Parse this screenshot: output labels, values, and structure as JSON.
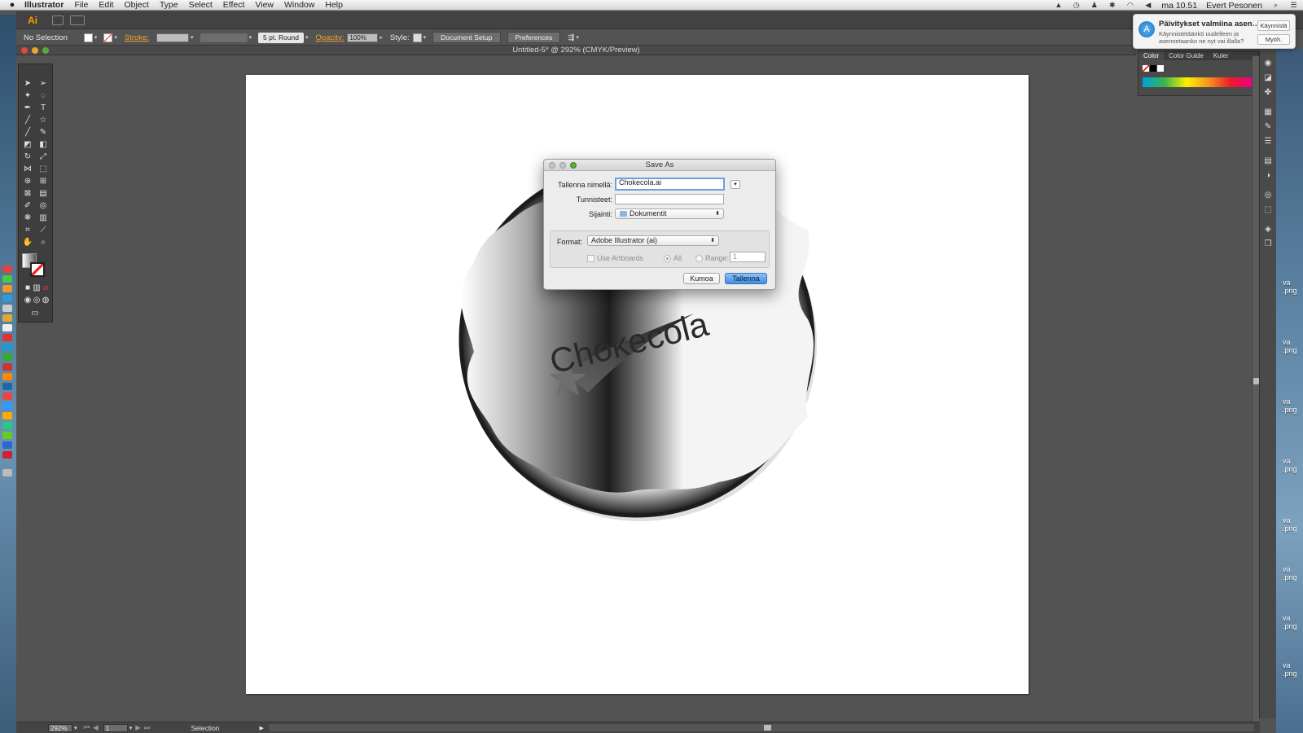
{
  "menubar": {
    "app_name": "Illustrator",
    "items": [
      "File",
      "Edit",
      "Object",
      "Type",
      "Select",
      "Effect",
      "View",
      "Window",
      "Help"
    ],
    "clock": "ma 10.51",
    "user": "Evert Pesonen"
  },
  "appbar": {
    "logo": "Ai"
  },
  "control_bar": {
    "selection": "No Selection",
    "stroke_label": "Stroke:",
    "brush_label": "5 pt. Round",
    "opacity_label": "Opacity:",
    "opacity_value": "100%",
    "style_label": "Style:",
    "document_setup": "Document Setup",
    "preferences": "Preferences"
  },
  "document": {
    "title": "Untitled-5* @ 292% (CMYK/Preview)"
  },
  "artwork": {
    "text": "Chokecola"
  },
  "notification": {
    "title": "Päivitykset valmiina asen…",
    "body": "Käynnistetäänkö uudelleen ja asennetaanko ne nyt vai illalla?",
    "primary": "Käynnistä",
    "secondary": "Myöh."
  },
  "color_panel": {
    "tabs": [
      "Color",
      "Color Guide",
      "Kuler"
    ]
  },
  "save_dialog": {
    "title": "Save As",
    "name_label": "Tallenna nimellä:",
    "name_value": "Chokecola.ai",
    "tags_label": "Tunnisteet:",
    "tags_value": "",
    "location_label": "Sijainti:",
    "location_value": "Dokumentit",
    "format_label": "Format:",
    "format_value": "Adobe Illustrator (ai)",
    "use_artboards": "Use Artboards",
    "all": "All",
    "range": "Range:",
    "range_value": "1",
    "cancel": "Kumoa",
    "save": "Tallenna"
  },
  "status_bar": {
    "zoom": "292%",
    "page": "1",
    "mode": "Selection"
  },
  "desktop_files": [
    "va\n.png",
    "va\n.png",
    "va\n.png",
    "va\n.png",
    "va\n.png",
    "va\n.png",
    "va\n.png",
    "va\n.png",
    "va\n.png"
  ]
}
